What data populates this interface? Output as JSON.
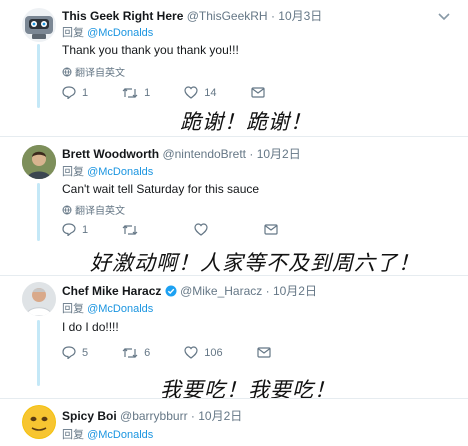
{
  "tweets": [
    {
      "name": "This Geek Right Here",
      "handle": "@ThisGeekRH",
      "date": "· 10月3日",
      "reply_prefix": "回复",
      "reply_to": "@McDonalds",
      "text": "Thank you thank you thank you!!!",
      "translate": "翻译自英文",
      "reply_count": "1",
      "retweet_count": "1",
      "like_count": "14",
      "caption": "跪谢！跪谢！"
    },
    {
      "name": "Brett Woodworth",
      "handle": "@nintendoBrett",
      "date": "· 10月2日",
      "reply_prefix": "回复",
      "reply_to": "@McDonalds",
      "text": "Can't wait tell Saturday for this sauce",
      "translate": "翻译自英文",
      "reply_count": "1",
      "retweet_count": "",
      "like_count": "",
      "caption": "好激动啊！人家等不及到周六了！"
    },
    {
      "name": "Chef Mike Haracz",
      "handle": "@Mike_Haracz",
      "date": "· 10月2日",
      "reply_prefix": "回复",
      "reply_to": "@McDonalds",
      "text": "I do I do!!!!",
      "reply_count": "5",
      "retweet_count": "6",
      "like_count": "106",
      "caption": "我要吃！我要吃！"
    },
    {
      "name": "Spicy Boi",
      "handle": "@barrybburr",
      "date": "· 10月2日",
      "reply_prefix": "回复",
      "reply_to": "@McDonalds"
    }
  ],
  "colors": {
    "accent": "#1b95e0",
    "muted": "#657786",
    "thread": "#c4e8f7",
    "verified": "#1da1f2"
  },
  "icons": [
    "reply-icon",
    "retweet-icon",
    "like-icon",
    "dm-icon",
    "globe-icon",
    "caret-down-icon",
    "verified-badge-icon"
  ]
}
